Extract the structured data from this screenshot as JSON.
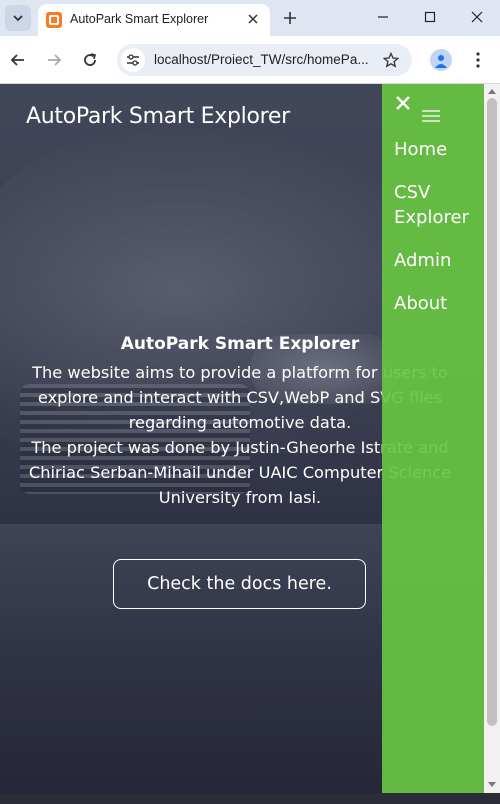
{
  "browser": {
    "tab_title": "AutoPark Smart Explorer",
    "url": "localhost/Proiect_TW/src/homePa...",
    "icons": {
      "tab_list": "chevron-down-icon",
      "favicon": "xampp-icon",
      "tab_close": "close-icon",
      "new_tab": "plus-icon",
      "minimize": "minimize-icon",
      "maximize": "maximize-icon",
      "close_window": "close-icon",
      "back": "arrow-left-icon",
      "forward": "arrow-right-icon",
      "reload": "reload-icon",
      "site_info": "tune-icon",
      "bookmark": "star-icon",
      "profile": "person-icon",
      "menu": "kebab-icon"
    }
  },
  "page": {
    "site_title": "AutoPark Smart Explorer",
    "content_title": "AutoPark Smart Explorer",
    "content_text_1": "The website aims to provide a platform for users to explore and interact with CSV,WebP and SVG files regarding automotive data.",
    "content_text_2": "The project was done by Justin-Gheorhe Istrate and Chiriac Serban-Mihail under UAIC Computer Science University from Iasi.",
    "docs_button": "Check the docs here."
  },
  "nav": {
    "items": [
      {
        "label": "Home"
      },
      {
        "label": "CSV Explorer"
      },
      {
        "label": "Admin"
      },
      {
        "label": "About"
      }
    ],
    "icons": {
      "close": "close-icon",
      "menu": "hamburger-icon"
    }
  },
  "colors": {
    "nav_green": "#68c442",
    "chrome_bg": "#dfe6f2",
    "accent_blue": "#1a73e8"
  }
}
